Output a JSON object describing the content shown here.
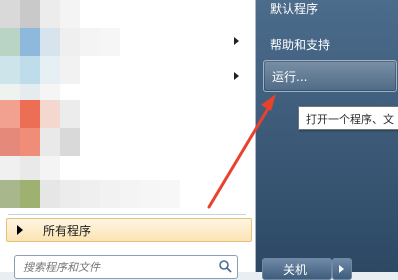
{
  "start_menu": {
    "pinned_program_arrows": [
      "chevron-right-icon",
      "chevron-right-icon"
    ],
    "all_programs_label": "所有程序",
    "search_placeholder": "搜索程序和文件",
    "right_items": {
      "default_programs": "默认程序",
      "help_support": "帮助和支持",
      "run": "运行..."
    },
    "tooltip": "打开一个程序、文",
    "shutdown_label": "关机"
  },
  "colors": {
    "right_pane": "#3e5c7a",
    "annotation_arrow": "#e8412c",
    "all_programs_bg": "#fbe3b3"
  }
}
